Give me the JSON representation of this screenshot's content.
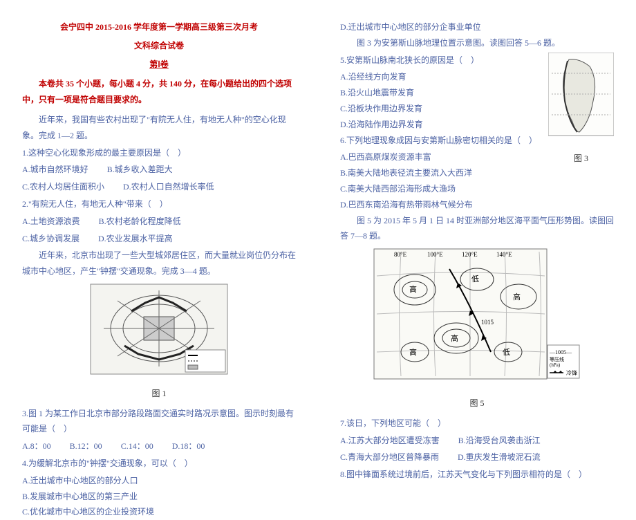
{
  "header": {
    "title": "会宁四中 2015-2016 学年度第一学期高三级第三次月考",
    "subject": "文科综合试卷",
    "part": "第Ⅰ卷",
    "instruction": "本卷共 35 个小题，每小题 4 分，共 140 分，在每小题给出的四个选项中，只有一项是符合题目要求的。"
  },
  "left": {
    "intro1": "近年来，我国有些农村出现了\"有院无人住，有地无人种\"的空心化现象。完成 1—2 题。",
    "q1": "1.这种空心化现象形成的最主要原因是（　）",
    "q1_opts_a": "A.城市自然环境好",
    "q1_opts_b": "B.城乡收入差距大",
    "q1_opts_c": "C.农村人均居住面积小",
    "q1_opts_d": "D.农村人口自然增长率低",
    "q2": "2.\"有院无人住，有地无人种\"带来（　）",
    "q2_opts_a": "A.土地资源浪费",
    "q2_opts_b": "B.农村老龄化程度降低",
    "q2_opts_c": "C.城乡协调发展",
    "q2_opts_d": "D.农业发展水平提高",
    "intro2": "近年来，北京市出现了一些大型城郊居住区，而大量就业岗位仍分布在城市中心地区，产生\"钟摆\"交通现象。完成 3—4 题。",
    "fig1_caption": "图 1",
    "q3": "3.图 1 为某工作日北京市部分路段路面交通实时路况示意图。图示时刻最有可能是（　）",
    "q3_a": "A.8：00",
    "q3_b": "B.12：00",
    "q3_c": "C.14：00",
    "q3_d": "D.18：00",
    "q4": "4.为缓解北京市的\"钟摆\"交通现象，可以（　）",
    "q4_a": "A.迁出城市中心地区的部分人口",
    "q4_b": "B.发展城市中心地区的第三产业",
    "q4_c": "C.优化城市中心地区的企业投资环境"
  },
  "right": {
    "q4_d": "D.迁出城市中心地区的部分企事业单位",
    "intro3": "图 3 为安第斯山脉地理位置示意图。读图回答 5—6 题。",
    "q5": "5.安第斯山脉南北狭长的原因是（　）",
    "q5_a": "A.沿经线方向发育",
    "q5_b": "B.沿火山地震带发育",
    "q5_c": "C.沿板块作用边界发育",
    "q5_d": "D.沿海陆作用边界发育",
    "q6": "6.下列地理现象成因与安第斯山脉密切相关的是（　）",
    "q6_a": "A.巴西高原煤炭资源丰富",
    "q6_b": "B.南美大陆地表径流主要流入大西洋",
    "q6_c": "C.南美大陆西部沿海形成大渔场",
    "q6_d": "D.巴西东南沿海有热带雨林气候分布",
    "fig3_caption": "图 3",
    "intro4": "图 5 为 2015 年 5 月 1 日 14 时亚洲部分地区海平面气压形势图。读图回答 7—8 题。",
    "fig5_caption": "图 5",
    "q7": "7.该日，下列地区可能（　）",
    "q7_a": "A.江苏大部分地区遭受冻害",
    "q7_b": "B.沿海受台风袭击浙江",
    "q7_c": "C.青海大部分地区普降暴雨",
    "q7_d": "D.重庆发生滑坡泥石流",
    "q8": "8.图中锋面系统过境前后，江苏天气变化与下列图示相符的是（　）",
    "legend_isobar": "—1005— 等压线(hPa)",
    "legend_front": "▲▲▲ 冷锋"
  }
}
